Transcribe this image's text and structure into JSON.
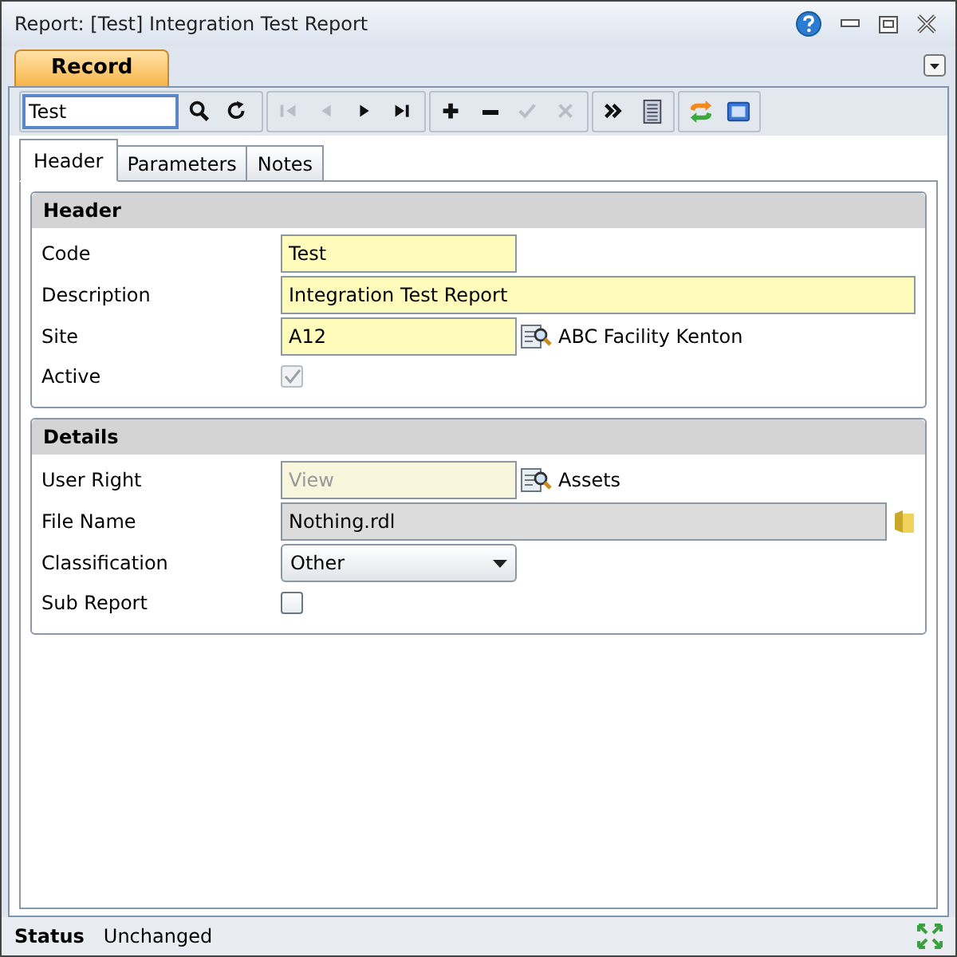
{
  "window": {
    "title": "Report: [Test] Integration Test Report"
  },
  "ribbon_tabs": [
    {
      "label": "Record",
      "selected": true
    }
  ],
  "toolbar": {
    "search_value": "Test",
    "groups": [
      [
        {
          "kind": "search"
        },
        {
          "kind": "refresh"
        }
      ],
      [
        {
          "kind": "first",
          "disabled": true
        },
        {
          "kind": "prev",
          "disabled": true
        },
        {
          "kind": "next",
          "disabled": false
        },
        {
          "kind": "last",
          "disabled": false
        }
      ],
      [
        {
          "kind": "add",
          "disabled": false
        },
        {
          "kind": "remove",
          "disabled": false
        },
        {
          "kind": "accept",
          "disabled": true
        },
        {
          "kind": "cancel",
          "disabled": true
        }
      ],
      [
        {
          "kind": "more"
        },
        {
          "kind": "list"
        }
      ],
      [
        {
          "kind": "sync"
        },
        {
          "kind": "panel"
        }
      ]
    ]
  },
  "tabs": [
    {
      "label": "Header",
      "selected": true
    },
    {
      "label": "Parameters",
      "selected": false
    },
    {
      "label": "Notes",
      "selected": false
    }
  ],
  "sections": [
    {
      "title": "Header",
      "fields": [
        {
          "kind": "text",
          "label": "Code",
          "value": "Test",
          "wide": false,
          "disabled": false
        },
        {
          "kind": "text",
          "label": "Description",
          "value": "Integration Test Report",
          "wide": true,
          "disabled": false
        },
        {
          "kind": "lookup",
          "label": "Site",
          "value": "A12",
          "lookup_text": "ABC Facility Kenton",
          "disabled": false
        },
        {
          "kind": "checkbox",
          "label": "Active",
          "checked": true,
          "disabled": true
        }
      ]
    },
    {
      "title": "Details",
      "fields": [
        {
          "kind": "lookup",
          "label": "User Right",
          "value": "View",
          "lookup_text": "Assets",
          "disabled": true
        },
        {
          "kind": "file",
          "label": "File Name",
          "value": "Nothing.rdl"
        },
        {
          "kind": "dropdown",
          "label": "Classification",
          "value": "Other"
        },
        {
          "kind": "checkbox",
          "label": "Sub Report",
          "checked": false,
          "disabled": false
        }
      ]
    }
  ],
  "status_bar": {
    "label": "Status",
    "value": "Unchanged"
  }
}
